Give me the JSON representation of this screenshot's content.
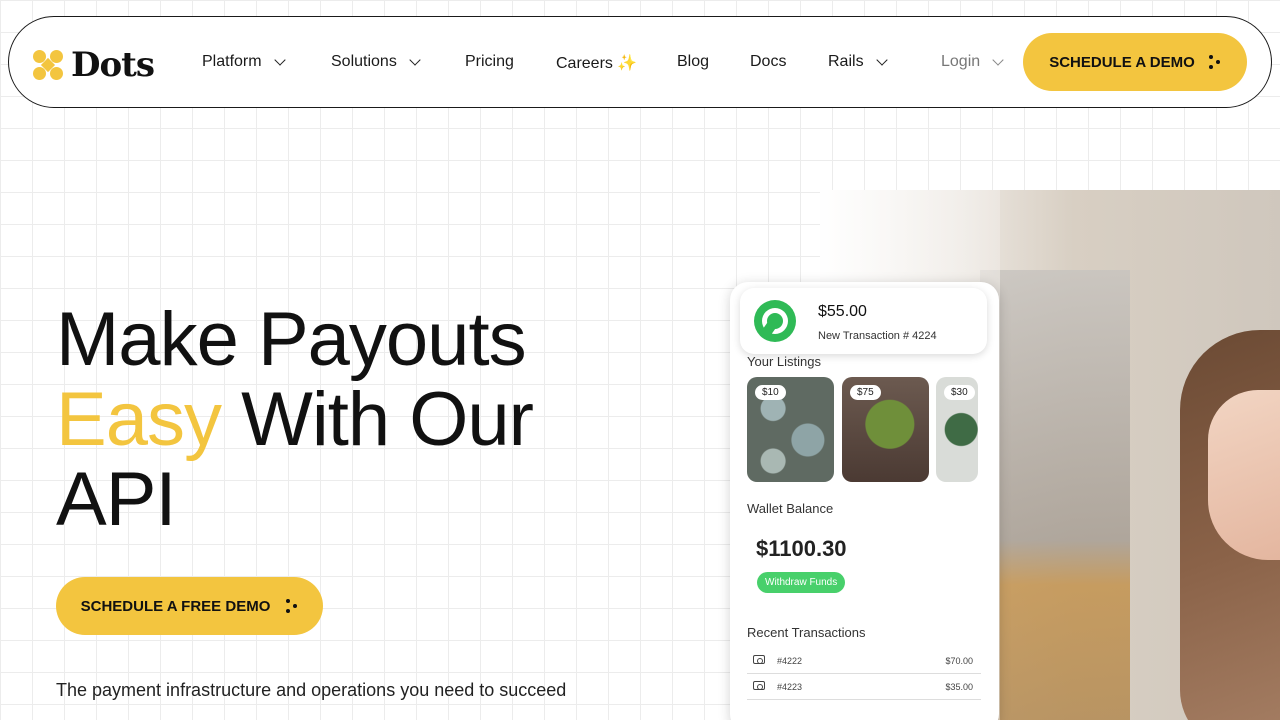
{
  "brand": {
    "name": "Dots",
    "accent": "#f3c53f",
    "green": "#48d06b"
  },
  "nav": {
    "items": [
      {
        "label": "Platform",
        "has_dropdown": true
      },
      {
        "label": "Solutions",
        "has_dropdown": true
      },
      {
        "label": "Pricing",
        "has_dropdown": false
      },
      {
        "label": "Careers ✨",
        "has_dropdown": false
      },
      {
        "label": "Blog",
        "has_dropdown": false
      },
      {
        "label": "Docs",
        "has_dropdown": false
      },
      {
        "label": "Rails",
        "has_dropdown": true
      }
    ],
    "login": "Login",
    "cta": "SCHEDULE A DEMO"
  },
  "hero": {
    "line1": "Make Payouts",
    "accent_word": "Easy",
    "line2_rest": " With Our",
    "line3": "API",
    "cta": "SCHEDULE A FREE DEMO",
    "subtitle": "The payment infrastructure and operations you need to succeed"
  },
  "phone": {
    "notification": {
      "amount": "$55.00",
      "text": "New Transaction # 4224",
      "icon": "dots-payout-icon"
    },
    "listings_title": "Your Listings",
    "listings": [
      {
        "price": "$10",
        "image": "succulents-photo"
      },
      {
        "price": "$75",
        "image": "monstera-plant-photo"
      },
      {
        "price": "$30",
        "image": "plant-photo"
      }
    ],
    "wallet_title": "Wallet Balance",
    "wallet_balance": "$1100.30",
    "withdraw_label": "Withdraw Funds",
    "recent_title": "Recent Transactions",
    "transactions": [
      {
        "id": "#4222",
        "amount": "$70.00",
        "icon": "cash-icon"
      },
      {
        "id": "#4223",
        "amount": "$35.00",
        "icon": "cash-icon"
      }
    ]
  }
}
